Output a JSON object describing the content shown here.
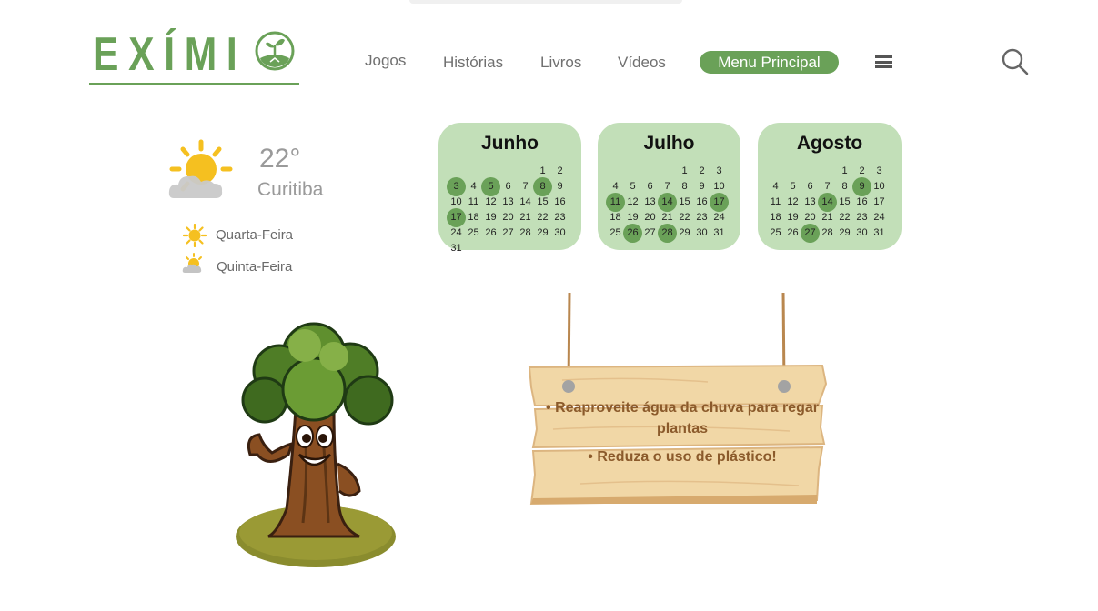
{
  "brand": {
    "name": "EXÍMI"
  },
  "nav": {
    "links": [
      "Jogos",
      "Histórias",
      "Livros",
      "Vídeos"
    ],
    "menu_button": "Menu Principal"
  },
  "weather": {
    "temp": "22°",
    "city": "Curitiba",
    "forecast": [
      {
        "day": "Quarta-Feira",
        "icon": "sun-icon"
      },
      {
        "day": "Quinta-Feira",
        "icon": "partly-cloudy-icon"
      }
    ]
  },
  "calendars": [
    {
      "month": "Junho",
      "offset": 5,
      "days": 31,
      "highlight": [
        3,
        5,
        8,
        17
      ]
    },
    {
      "month": "Julho",
      "offset": 4,
      "days": 31,
      "highlight": [
        11,
        14,
        17,
        26,
        28
      ]
    },
    {
      "month": "Agosto",
      "offset": 4,
      "days": 31,
      "highlight": [
        9,
        14,
        27
      ]
    }
  ],
  "tips": [
    "• Reaproveite água da chuva para regar plantas",
    "• Reduza o uso de plástico!"
  ],
  "colors": {
    "brand_green": "#6aa158",
    "calendar_bg": "#c2dfb8",
    "wood": "#f1d7a6",
    "tip_text": "#8b5a2b"
  }
}
